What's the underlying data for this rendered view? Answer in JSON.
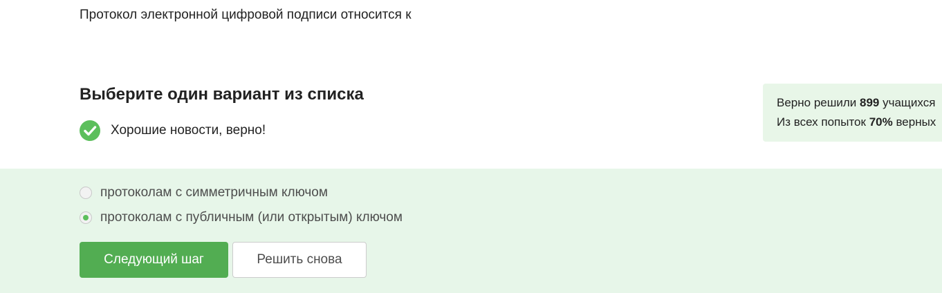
{
  "question": {
    "text": "Протокол электронной цифровой подписи относится к"
  },
  "quiz": {
    "title": "Выберите один вариант из списка",
    "feedback": "Хорошие новости, верно!"
  },
  "stats": {
    "solved_prefix": "Верно решили ",
    "solved_count": "899",
    "solved_suffix": " учащихся",
    "attempts_prefix": "Из всех попыток ",
    "attempts_percent": "70%",
    "attempts_suffix": " верных"
  },
  "options": [
    {
      "label": "протоколам с симметричным ключом",
      "selected": false
    },
    {
      "label": "протоколам с публичным (или открытым) ключом",
      "selected": true
    }
  ],
  "buttons": {
    "next_label": "Следующий шаг",
    "retry_label": "Решить снова"
  },
  "colors": {
    "accent_green": "#52ad52",
    "check_green": "#5cbf5c",
    "panel_bg": "#e7f6e9",
    "stats_bg": "#e8f6e8"
  },
  "icons": {
    "feedback": "checkmark-circle-icon"
  }
}
